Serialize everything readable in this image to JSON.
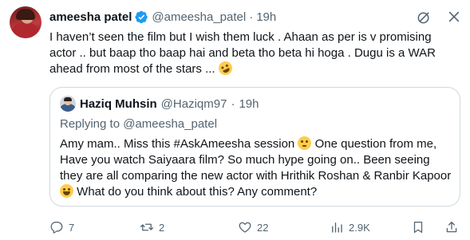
{
  "author": {
    "name": "ameesha patel",
    "handle": "@ameesha_patel",
    "dot": "·",
    "time": "19h",
    "avatar_icon": "avatar",
    "verified_color": "#1d9bf0"
  },
  "top_icons": [
    "grok-icon",
    "close-icon"
  ],
  "tweet": {
    "text": "I haven’t seen the film but I wish them luck . Ahaan as per is v promising actor .. but baap tho baap hai and beta tho beta hi hoga . Dugu is a WAR ahead  from most of the  stars ... "
  },
  "quote": {
    "name": "Haziq Muhsin",
    "handle": "@Haziqm97",
    "dot": "·",
    "time": "19h",
    "replying_prefix": "Replying to ",
    "replying_handle": "@ameesha_patel",
    "text_part1": "Amy mam.. Miss this #AskAmeesha session ",
    "text_part2": " One question from me, Have you watch Saiyaara film? So much hype going on.. Been seeing they are all comparing the new actor with Hrithik Roshan & Ranbir Kapoor ",
    "text_part3": " What do you think about this? Any comment?"
  },
  "actions": {
    "replies": "7",
    "reposts": "2",
    "likes": "22",
    "views": "2.9K"
  },
  "colors": {
    "text": "#0f1419",
    "secondary": "#536471",
    "border": "#cfd9de",
    "accent": "#1d9bf0"
  }
}
